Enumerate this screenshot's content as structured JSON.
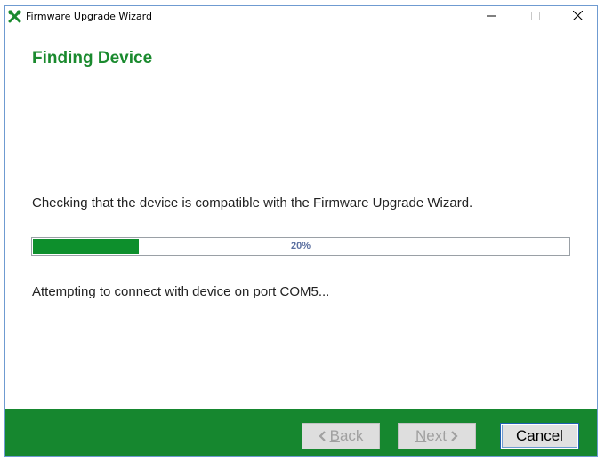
{
  "window": {
    "title": "Firmware Upgrade Wizard"
  },
  "page": {
    "heading": "Finding Device",
    "description": "Checking that the device is compatible with the Firmware Upgrade Wizard.",
    "status": "Attempting to connect with device on port COM5..."
  },
  "progress": {
    "value": 0.2,
    "label": "20%"
  },
  "buttons": {
    "back": {
      "mnemonic": "B",
      "rest": "ack",
      "enabled": false
    },
    "next": {
      "mnemonic": "N",
      "rest": "ext",
      "enabled": false
    },
    "cancel": {
      "label": "Cancel",
      "enabled": true
    }
  },
  "colors": {
    "accent_green": "#16872f",
    "heading_green": "#1a8a2e",
    "progress_fill": "#0d8f2c"
  },
  "icons": {
    "app": "wrench-screwdriver-icon",
    "minimize": "minimize-icon",
    "maximize": "maximize-icon",
    "close": "close-icon",
    "back": "chevron-left-icon",
    "next": "chevron-right-icon"
  }
}
